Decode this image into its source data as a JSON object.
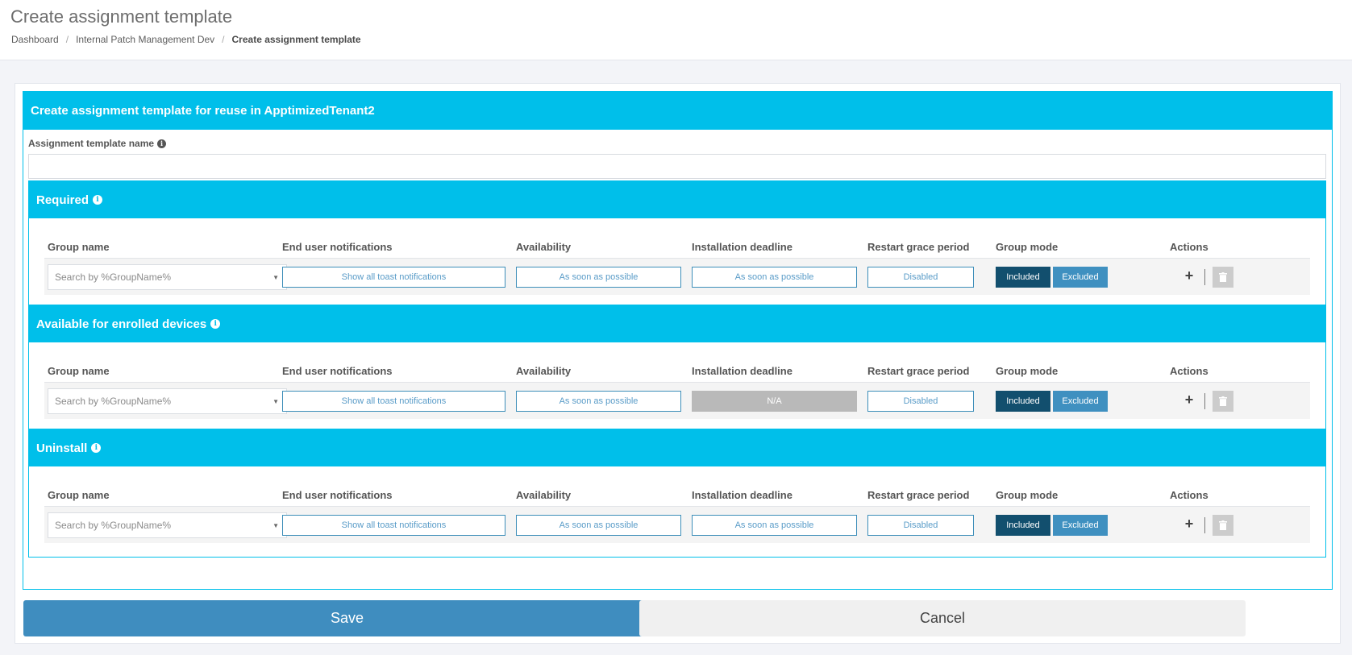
{
  "page": {
    "title": "Create assignment template",
    "breadcrumb": [
      "Dashboard",
      "Internal Patch Management Dev",
      "Create assignment template"
    ]
  },
  "panel": {
    "title": "Create assignment template for reuse in ApptimizedTenant2",
    "name_label": "Assignment template name",
    "name_value": ""
  },
  "columns": [
    "Group name",
    "End user notifications",
    "Availability",
    "Installation deadline",
    "Restart grace period",
    "Group mode",
    "Actions"
  ],
  "sections": [
    {
      "title": "Required",
      "row": {
        "group_placeholder": "Search by %GroupName%",
        "notifications": "Show all toast notifications",
        "availability": "As soon as possible",
        "deadline": "As soon as possible",
        "restart": "Disabled",
        "included": "Included",
        "excluded": "Excluded"
      }
    },
    {
      "title": "Available for enrolled devices",
      "row": {
        "group_placeholder": "Search by %GroupName%",
        "notifications": "Show all toast notifications",
        "availability": "As soon as possible",
        "deadline": "N/A",
        "restart": "Disabled",
        "included": "Included",
        "excluded": "Excluded"
      }
    },
    {
      "title": "Uninstall",
      "row": {
        "group_placeholder": "Search by %GroupName%",
        "notifications": "Show all toast notifications",
        "availability": "As soon as possible",
        "deadline": "As soon as possible",
        "restart": "Disabled",
        "included": "Included",
        "excluded": "Excluded"
      }
    }
  ],
  "footer": {
    "save": "Save",
    "cancel": "Cancel"
  },
  "icons": {
    "info": "info-icon",
    "caret": "chevron-down-icon",
    "add": "plus-icon",
    "delete": "trash-icon"
  },
  "colors": {
    "accent": "#00bfea",
    "primary": "#3f8dbf",
    "included": "#124f6e",
    "excluded": "#3f90c0",
    "disabled": "#b9b9b9"
  }
}
